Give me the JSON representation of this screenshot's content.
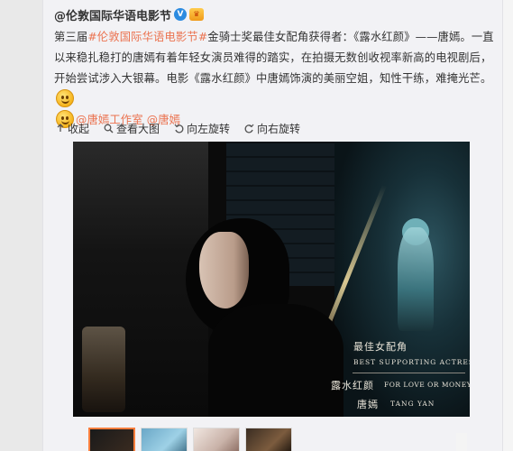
{
  "post": {
    "author": "@伦敦国际华语电影节",
    "verified_badge": "V",
    "text_parts": [
      "第三届",
      "#伦敦国际华语电影节#",
      "金骑士奖最佳女配角获得者：《露水红颜》——唐嫣。一直以来稳扎稳打的唐嫣有着年轻女演员难得的踏实，在拍摄无数创收视率新高的电视剧后，开始尝试涉入大银幕。电影《露水红颜》中唐嫣饰演的美丽空姐，知性干练，难掩光芒。"
    ],
    "mentions": [
      "@唐嫣工作室",
      "@唐嫣"
    ]
  },
  "toolbar": {
    "collapse": "收起",
    "view_large": "查看大图",
    "rotate_left": "向左旋转",
    "rotate_right": "向右旋转"
  },
  "image_caption": {
    "award_cn": "最佳女配角",
    "award_en": "BEST SUPPORTING ACTRESS",
    "title_cn": "露水红颜",
    "title_en": "FOR LOVE OR MONEY",
    "name_cn": "唐嫣",
    "name_en": "TANG YAN"
  },
  "colors": {
    "link": "#eb7350",
    "text": "#333333",
    "verified": "#2c8be0",
    "thumb_active": "#fa7d3c"
  }
}
